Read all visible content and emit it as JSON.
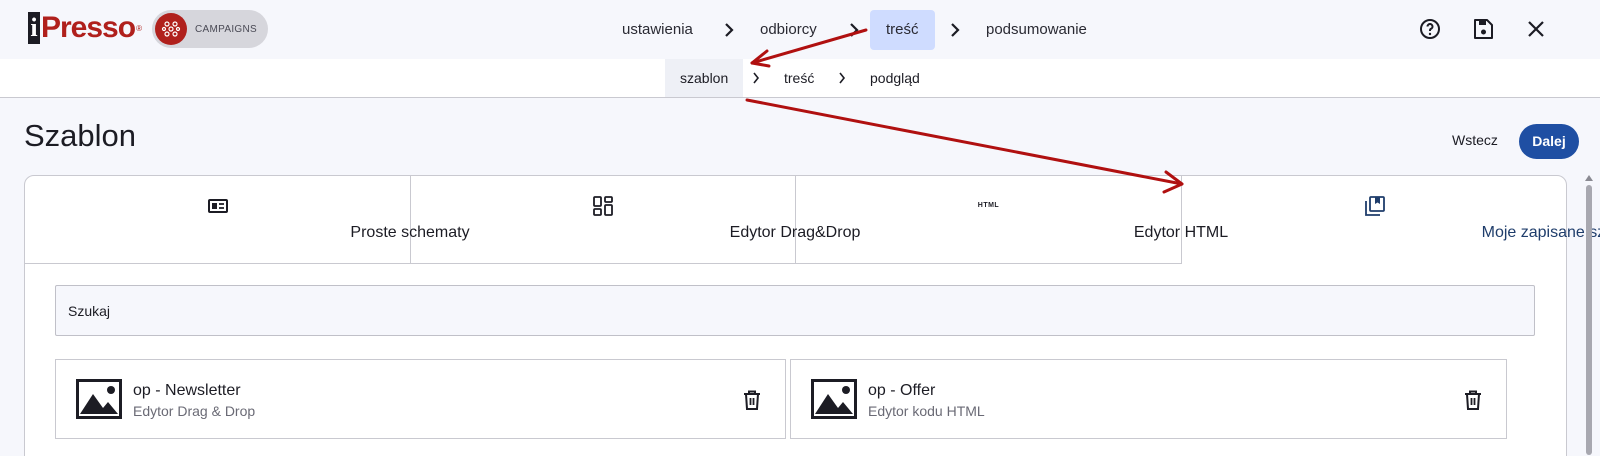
{
  "brand": {
    "logo_text": "Presso",
    "logo_i": "i",
    "logo_reg": "®",
    "product": "CAMPAIGNS",
    "logo_color": "#b0201c"
  },
  "steps": [
    {
      "label": "ustawienia"
    },
    {
      "label": "odbiorcy"
    },
    {
      "label": "treść"
    },
    {
      "label": "podsumowanie"
    }
  ],
  "active_step": "treść",
  "top_icons": [
    "help-icon",
    "save-icon",
    "close-icon"
  ],
  "sub_steps": [
    {
      "label": "szablon"
    },
    {
      "label": "treść"
    },
    {
      "label": "podgląd"
    }
  ],
  "active_sub_step": "szablon",
  "page": {
    "title": "Szablon",
    "back_label": "Wstecz",
    "next_label": "Dalej"
  },
  "tabs": [
    {
      "label": "Proste schematy",
      "icon": "layout-icon"
    },
    {
      "label": "Edytor Drag&Drop",
      "icon": "dashboard-icon"
    },
    {
      "label": "Edytor HTML",
      "icon": "html-icon",
      "icon_text": "HTML"
    },
    {
      "label": "Moje zapisane szablony",
      "icon": "saved-templates-icon"
    }
  ],
  "active_tab": "Moje zapisane szablony",
  "search": {
    "placeholder": "Szukaj",
    "value": ""
  },
  "templates": [
    {
      "name": "op - Newsletter",
      "type": "Edytor Drag & Drop"
    },
    {
      "name": "op - Offer",
      "type": "Edytor kodu HTML"
    }
  ],
  "colors": {
    "accent": "#1f4fa3",
    "active_step_bg": "#cfdcff",
    "annotation": "#b01010"
  }
}
